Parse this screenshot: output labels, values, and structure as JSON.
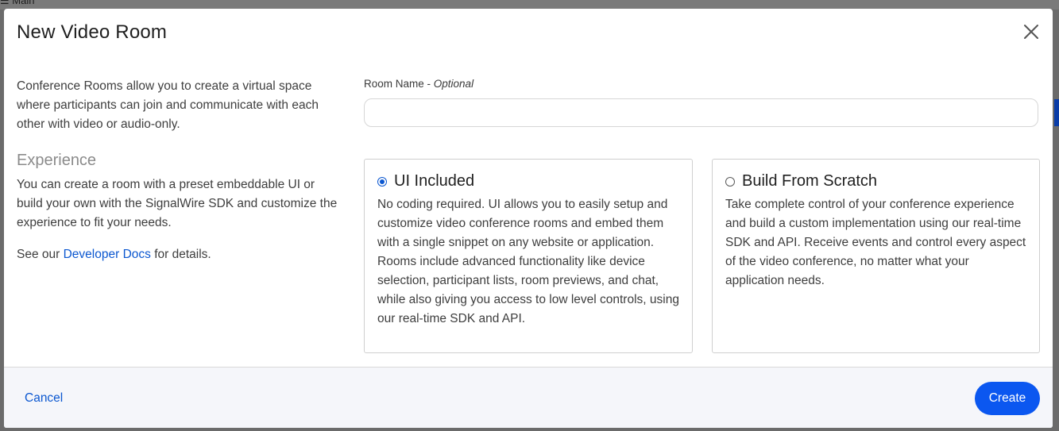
{
  "background": {
    "breadcrumb": "☰ Main"
  },
  "modal": {
    "title": "New Video Room",
    "intro": "Conference Rooms allow you to create a virtual space where participants can join and communicate with each other with video or audio-only.",
    "experience_heading": "Experience",
    "experience_text": "You can create a room with a preset embeddable UI or build your own with the SignalWire SDK and customize the experience to fit your needs.",
    "docs_prefix": "See our ",
    "docs_link": "Developer Docs",
    "docs_suffix": " for details.",
    "room_name_label": "Room Name - ",
    "room_name_optional": "Optional",
    "room_name_value": "",
    "room_name_placeholder": "",
    "options": [
      {
        "title": "UI Included",
        "selected": true,
        "description": "No coding required. UI allows you to easily setup and customize video conference rooms and embed them with a single snippet on any website or application. Rooms include advanced functionality like device selection, participant lists, room previews, and chat, while also giving you access to low level controls, using our real-time SDK and API."
      },
      {
        "title": "Build From Scratch",
        "selected": false,
        "description": "Take complete control of your conference experience and build a custom implementation using our real-time SDK and API. Receive events and control every aspect of the video conference, no matter what your application needs."
      }
    ],
    "cancel_label": "Cancel",
    "create_label": "Create"
  },
  "colors": {
    "accent": "#0b57d0",
    "primary_button": "#0b57f0",
    "footer_bg": "#f5f6fa"
  }
}
